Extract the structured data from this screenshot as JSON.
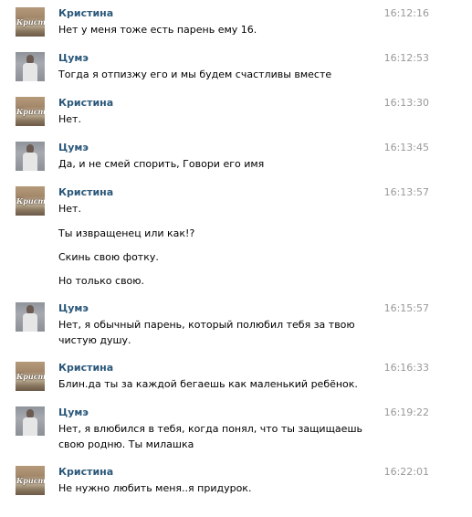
{
  "messages": [
    {
      "author": "Кристина",
      "time": "16:12:16",
      "avatar": "kristina-avatar",
      "lines": [
        "Нет у меня тоже есть парень ему 16."
      ]
    },
    {
      "author": "Цумэ",
      "time": "16:12:53",
      "avatar": "tsume-avatar",
      "lines": [
        "Тогда я отпизжу его и мы будем счастливы вместе"
      ]
    },
    {
      "author": "Кристина",
      "time": "16:13:30",
      "avatar": "kristina-avatar",
      "lines": [
        "Нет."
      ]
    },
    {
      "author": "Цумэ",
      "time": "16:13:45",
      "avatar": "tsume-avatar",
      "lines": [
        "Да, и не смей спорить, Говори его имя"
      ]
    },
    {
      "author": "Кристина",
      "time": "16:13:57",
      "avatar": "kristina-avatar",
      "lines": [
        "Нет.",
        "Ты извращенец или как!?",
        "Скинь свою фотку.",
        "Но только свою."
      ]
    },
    {
      "author": "Цумэ",
      "time": "16:15:57",
      "avatar": "tsume-avatar",
      "lines": [
        "Нет, я обычный парень, который полюбил тебя за твою чистую душу."
      ]
    },
    {
      "author": "Кристина",
      "time": "16:16:33",
      "avatar": "kristina-avatar",
      "lines": [
        "Блин.да ты за каждой бегаешь как маленький ребёнок."
      ]
    },
    {
      "author": "Цумэ",
      "time": "16:19:22",
      "avatar": "tsume-avatar",
      "lines": [
        "Нет, я влюбился в тебя, когда понял, что ты защищаешь свою родню. Ты милашка"
      ]
    },
    {
      "author": "Кристина",
      "time": "16:22:01",
      "avatar": "kristina-avatar",
      "lines": [
        "Не нужно любить меня..я придурок."
      ]
    }
  ],
  "avatar_labels": {
    "kristina": "Кристина"
  }
}
